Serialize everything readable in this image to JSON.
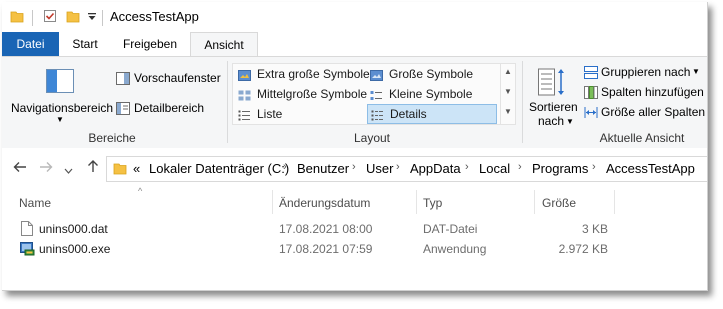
{
  "window": {
    "title": "AccessTestApp"
  },
  "ribbon_tabs": [
    {
      "label": "Datei"
    },
    {
      "label": "Start"
    },
    {
      "label": "Freigeben"
    },
    {
      "label": "Ansicht"
    }
  ],
  "ribbon": {
    "bereiche": {
      "navigation_pane": "Navigationsbereich",
      "preview_pane": "Vorschaufenster",
      "details_pane": "Detailbereich",
      "group_label": "Bereiche"
    },
    "layout": {
      "items": [
        "Extra große Symbole",
        "Große Symbole",
        "Mittelgroße Symbole",
        "Kleine Symbole",
        "Liste",
        "Details"
      ],
      "selected": "Details",
      "group_label": "Layout"
    },
    "current_view": {
      "sort_line1": "Sortieren",
      "sort_line2": "nach",
      "group_by": "Gruppieren nach",
      "add_columns": "Spalten hinzufügen",
      "size_all_columns": "Größe aller Spalten",
      "group_label": "Aktuelle Ansicht"
    }
  },
  "address_bar": {
    "prefix": "«",
    "path": [
      "Lokaler Datenträger (C:)",
      "Benutzer",
      "User",
      "AppData",
      "Local",
      "Programs",
      "AccessTestApp"
    ]
  },
  "file_list": {
    "columns": [
      "Name",
      "Änderungsdatum",
      "Typ",
      "Größe"
    ],
    "rows": [
      {
        "name": "unins000.dat",
        "date": "17.08.2021 08:00",
        "type": "DAT-Datei",
        "size": "3 KB",
        "icon": "file-icon"
      },
      {
        "name": "unins000.exe",
        "date": "17.08.2021 07:59",
        "type": "Anwendung",
        "size": "2.972 KB",
        "icon": "exe-icon"
      }
    ]
  },
  "colors": {
    "file_tab": "#1a65b5",
    "folder": "#f5c144",
    "selection": "#cce4f7"
  }
}
